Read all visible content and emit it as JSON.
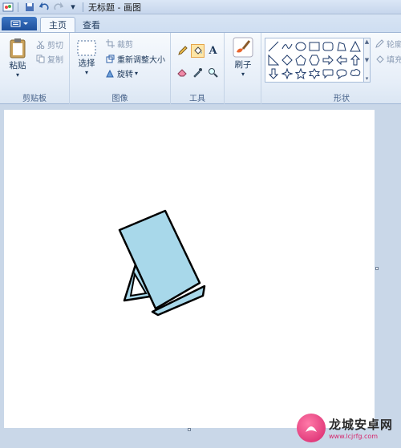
{
  "title_bar": {
    "title": "无标题 - 画图"
  },
  "tabs": [
    {
      "label": "主页",
      "active": true
    },
    {
      "label": "查看",
      "active": false
    }
  ],
  "file_button": {
    "icon": "app-menu-icon"
  },
  "ribbon": {
    "clipboard": {
      "label": "剪贴板",
      "paste": "粘贴",
      "cut": "剪切",
      "copy": "复制"
    },
    "image": {
      "label": "图像",
      "select": "选择",
      "crop": "裁剪",
      "resize": "重新调整大小",
      "rotate": "旋转"
    },
    "tools": {
      "label": "工具",
      "selected_tool": "fill-bucket"
    },
    "brushes": {
      "label": "刷子"
    },
    "shapes": {
      "label": "形状",
      "outline": "轮廓",
      "fill": "填充"
    }
  },
  "canvas": {
    "background": "#ffffff",
    "drawing": "phone-stand",
    "stand_fill": "#a8d8ea",
    "stroke": "#000000"
  },
  "watermark": {
    "title": "龙城安卓网",
    "url": "www.lcjrfg.com"
  }
}
